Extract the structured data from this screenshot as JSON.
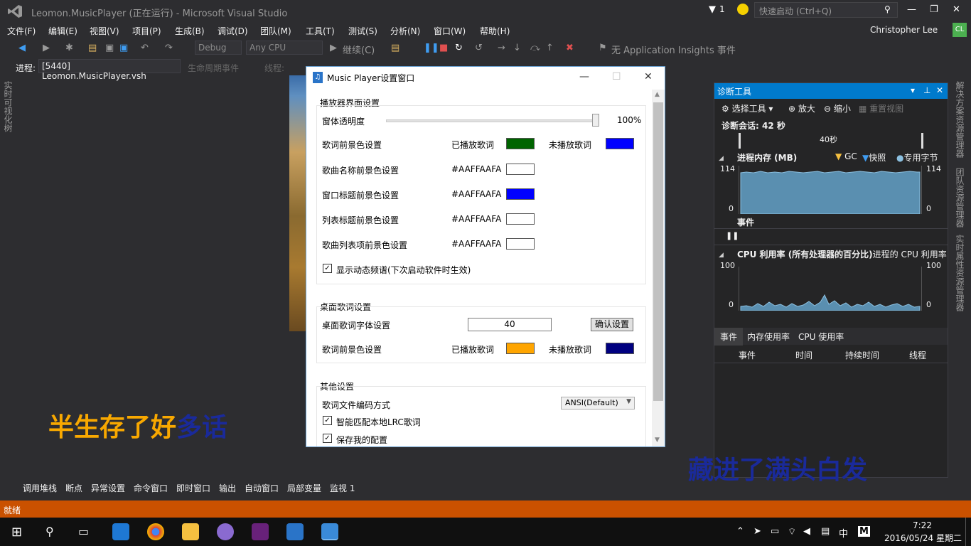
{
  "vs": {
    "title": "Leomon.MusicPlayer (正在运行) - Microsoft Visual Studio",
    "filter_count": "1",
    "quick_launch_placeholder": "快速启动 (Ctrl+Q)",
    "user_name": "Christopher Lee",
    "user_initials": "CL",
    "menu": [
      "文件(F)",
      "编辑(E)",
      "视图(V)",
      "项目(P)",
      "生成(B)",
      "调试(D)",
      "团队(M)",
      "工具(T)",
      "测试(S)",
      "分析(N)",
      "窗口(W)",
      "帮助(H)"
    ],
    "toolbar": {
      "config": "Debug",
      "platform": "Any CPU",
      "continue": "继续(C)",
      "insights": "无 Application Insights 事件"
    },
    "toolbar2": {
      "process_label": "进程:",
      "process_value": "[5440] Leomon.MusicPlayer.vsh",
      "lifecycle": "生命周期事件",
      "thread_label": "线程:"
    },
    "left_tab": "实时可视化树",
    "right_tabs": [
      "解决方案资源管理器",
      "团队资源管理器",
      "实时属性资源管理器"
    ],
    "bottom_tabs": [
      "调用堆栈",
      "断点",
      "异常设置",
      "命令窗口",
      "即时窗口",
      "输出",
      "自动窗口",
      "局部变量",
      "监视 1"
    ],
    "status": "就绪"
  },
  "dialog": {
    "title": "Music Player设置窗口",
    "player_group": {
      "heading": "播放器界面设置",
      "opacity_label": "窗体透明度",
      "opacity_value": "100%",
      "opacity_level": 1.0,
      "lyric_fg_label": "歌词前景色设置",
      "played_label": "已播放歌词",
      "unplayed_label": "未播放歌词",
      "played_color": "#006400",
      "unplayed_color": "#0000FF",
      "song_name_label": "歌曲名称前景色设置",
      "song_name_value": "#AAFFAAFA",
      "window_title_label": "窗口标题前景色设置",
      "window_title_value": "#AAFFAAFA",
      "window_title_color": "#0000FF",
      "list_title_label": "列表标题前景色设置",
      "list_title_value": "#AAFFAAFA",
      "list_item_label": "歌曲列表项前景色设置",
      "list_item_value": "#AAFFAAFA",
      "spectrum_label": "显示动态频谱(下次启动软件时生效)"
    },
    "desktop_group": {
      "heading": "桌面歌词设置",
      "font_label": "桌面歌词字体设置",
      "font_size": "40",
      "confirm": "确认设置",
      "fg_label": "歌词前景色设置",
      "played_label": "已播放歌词",
      "unplayed_label": "未播放歌词",
      "played_color": "#FFA500",
      "unplayed_color": "#000080"
    },
    "other_group": {
      "heading": "其他设置",
      "encoding_label": "歌词文件编码方式",
      "encoding_value": "ANSI(Default)",
      "lrc_match": "智能匹配本地LRC歌词",
      "save_config": "保存我的配置"
    }
  },
  "diagnostics": {
    "title": "诊断工具",
    "tools": [
      "选择工具",
      "放大",
      "缩小",
      "重置视图"
    ],
    "session": "诊断会话: 42 秒",
    "timeline_label": "40秒",
    "memory": {
      "heading": "进程内存 (MB)",
      "legend": [
        "GC",
        "快照",
        "专用字节"
      ],
      "max": "114",
      "min": "0"
    },
    "events_heading": "事件",
    "cpu": {
      "heading": "CPU 利用率 (所有处理器的百分比)",
      "heading_suffix": "进程的 CPU 利用率",
      "max": "100",
      "min": "0"
    },
    "tabs": [
      "事件",
      "内存使用率",
      "CPU 使用率"
    ],
    "columns": [
      "事件",
      "时间",
      "持续时间",
      "线程"
    ]
  },
  "lyrics": {
    "left_played": "半生存了好",
    "left_unplayed": "多话",
    "right": "藏进了满头白发"
  },
  "taskbar": {
    "time": "7:22",
    "date": "2016/05/24 星期二",
    "ime": "中"
  }
}
